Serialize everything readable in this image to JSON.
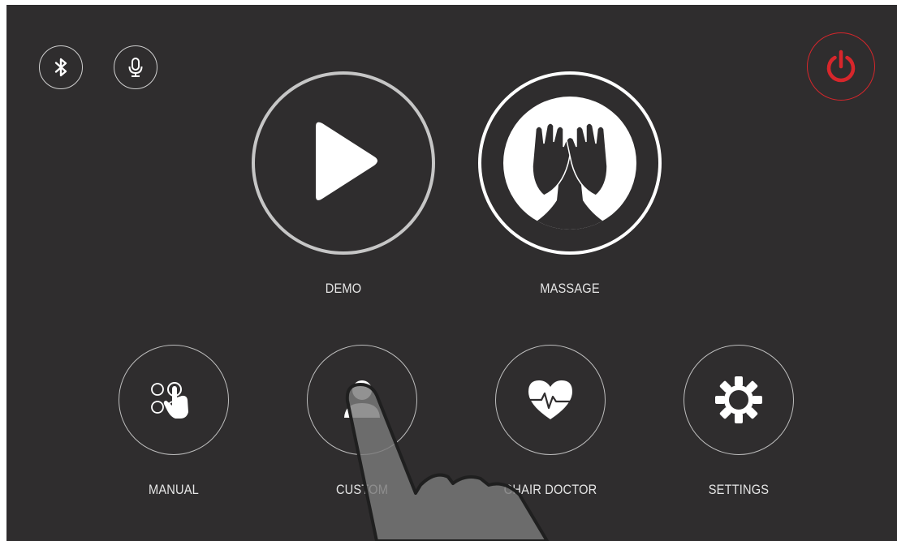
{
  "colors": {
    "background": "#2f2d2e",
    "power": "#d7262b",
    "foreground": "#ffffff",
    "label": "#e6e6e6"
  },
  "top_bar": {
    "left_icons": [
      "bluetooth-icon",
      "microphone-icon"
    ],
    "right_icons": [
      "power-icon"
    ]
  },
  "primary_modes": [
    {
      "label": "DEMO",
      "icon": "play-icon"
    },
    {
      "label": "MASSAGE",
      "icon": "massage-hands-icon"
    }
  ],
  "secondary_modes": [
    {
      "label": "MANUAL",
      "icon": "manual-touch-icon"
    },
    {
      "label": "CUSTOM",
      "icon": "user-icon"
    },
    {
      "label": "CHAIR DOCTOR",
      "icon": "heartbeat-icon"
    },
    {
      "label": "SETTINGS",
      "icon": "gear-icon"
    }
  ],
  "overlay": {
    "icon": "pointing-hand-icon"
  }
}
